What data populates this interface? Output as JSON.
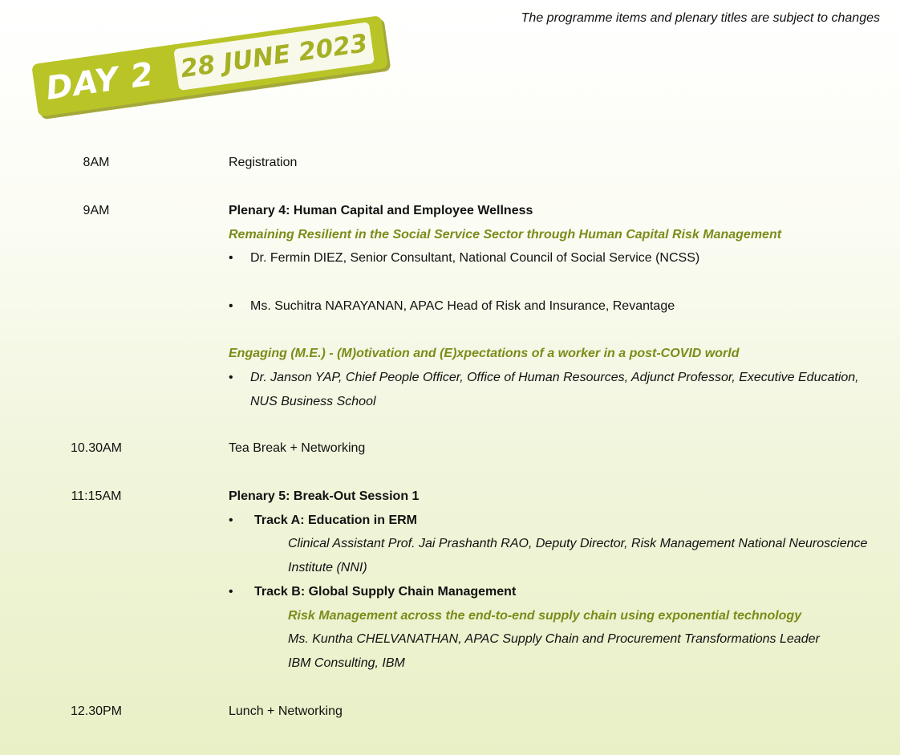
{
  "disclaimer": "The programme items and plenary titles are subject to changes",
  "banner": {
    "day": "DAY 2",
    "date": "28 JUNE 2023"
  },
  "bullet_char": "•",
  "rows": {
    "r1": {
      "time": "8AM",
      "text": "Registration"
    },
    "r2": {
      "time": "9AM",
      "title": "Plenary 4:  Human Capital and Employee Wellness",
      "sub1": "Remaining Resilient in the Social Service Sector through Human Capital Risk Management",
      "speaker1": "Dr. Fermin DIEZ, Senior Consultant, National Council of Social Service (NCSS)",
      "speaker2": "Ms. Suchitra NARAYANAN, APAC Head of Risk and Insurance,  Revantage",
      "sub2": "Engaging (M.E.) - (M)otivation and (E)xpectations of a worker in a post-COVID world",
      "speaker3_l1": "Dr. Janson YAP, Chief People Officer, Office of Human Resources, Adjunct Professor, Executive Education,",
      "speaker3_l2": "NUS Business School"
    },
    "r3": {
      "time": "10.30AM",
      "text": "Tea Break + Networking"
    },
    "r4": {
      "time": "11:15AM",
      "title": "Plenary 5:  Break-Out Session 1",
      "trackA": "Track A: Education in ERM",
      "trackA_speaker_l1": "Clinical Assistant Prof. Jai Prashanth RAO, Deputy Director, Risk Management National Neuroscience",
      "trackA_speaker_l2": "Institute (NNI)",
      "trackB": "Track B: Global Supply Chain Management",
      "trackB_topic": "Risk Management across the end-to-end supply chain using exponential technology",
      "trackB_speaker_l1": "Ms. Kuntha CHELVANATHAN, APAC Supply Chain and Procurement Transformations Leader",
      "trackB_speaker_l2": "IBM Consulting,  IBM"
    },
    "r5": {
      "time": "12.30PM",
      "text": "Lunch + Networking"
    }
  }
}
